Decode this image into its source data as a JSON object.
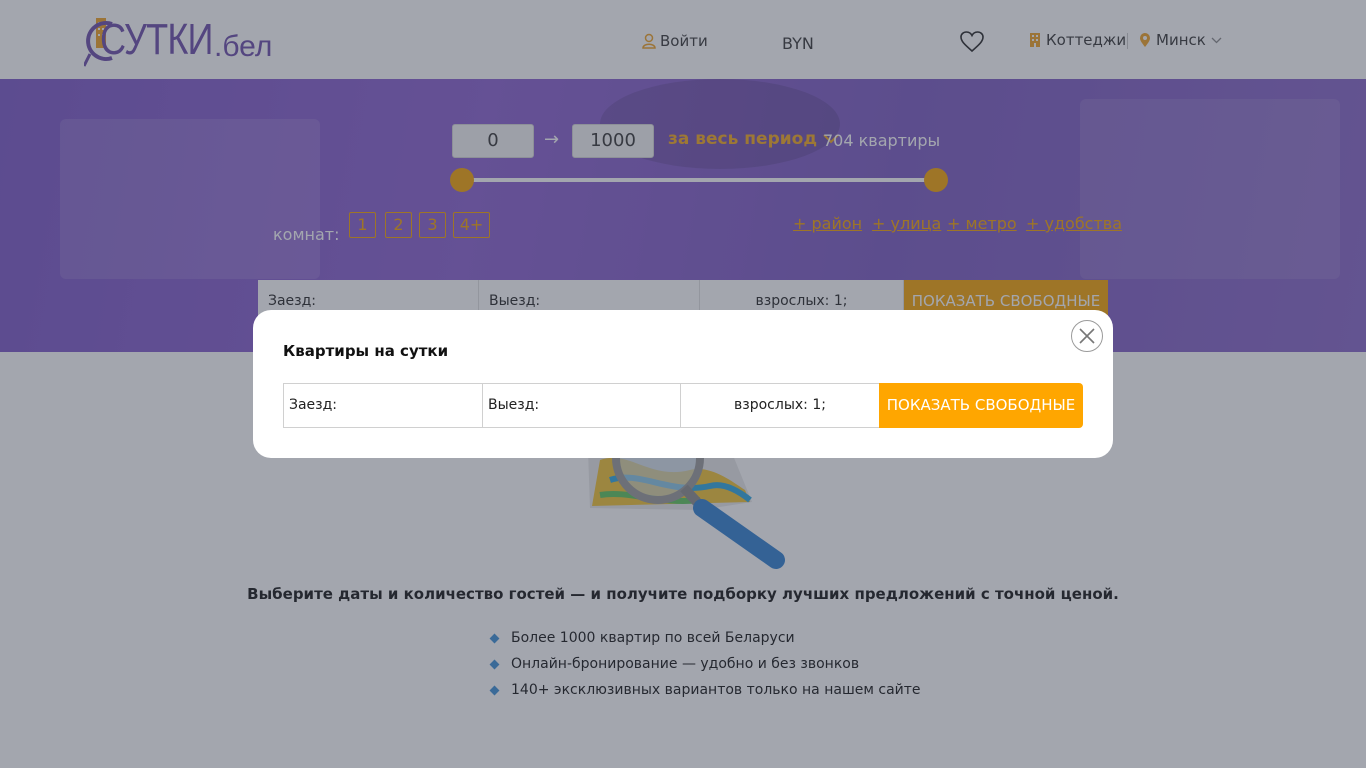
{
  "header": {
    "logo_main": "СУТКИ",
    "logo_suffix": ".бел",
    "login_label": "Войти",
    "currency": "BYN",
    "cottages_label": "Коттеджи",
    "city": "Минск"
  },
  "hero": {
    "price_min": "0",
    "price_max": "1000",
    "price_arrow": "→",
    "period_label": "за весь период",
    "listings_count": "704 квартиры",
    "price_range_fraction": [
      0,
      1
    ],
    "rooms_label": "комнат:",
    "rooms": [
      "1",
      "2",
      "3",
      "4+"
    ],
    "filters": [
      "+ район ",
      "+ улица ",
      "+ метро ",
      "+ удобства"
    ],
    "form": {
      "checkin_label": "Заезд:",
      "checkout_label": "Выезд:",
      "guests_label": "взрослых: 1;",
      "submit_label": "ПОКАЗАТЬ СВОБОДНЫЕ"
    }
  },
  "modal": {
    "title": "Квартиры на сутки",
    "checkin_label": "Заезд:",
    "checkout_label": "Выезд:",
    "guests_label": "взрослых: 1;",
    "submit_label": "ПОКАЗАТЬ СВОБОДНЫЕ"
  },
  "main": {
    "tagline": "Выберите даты и количество гостей — и получите подборку лучших предложений с точной ценой.",
    "benefits": [
      "Более 1000 квартир по всей Беларуси",
      "Онлайн-бронирование — удобно и без звонков",
      "140+ эксклюзивных вариантов только на нашем сайте"
    ]
  },
  "colors": {
    "brand_purple": "#6a4aa8",
    "accent_orange": "#f5a300",
    "bullet_blue": "#3a8fd6"
  },
  "icons": {
    "login": "user-icon",
    "favorites": "heart-icon",
    "cottages": "building-icon",
    "city": "map-pin-icon",
    "period": "chevron-down-icon",
    "close": "close-icon"
  }
}
